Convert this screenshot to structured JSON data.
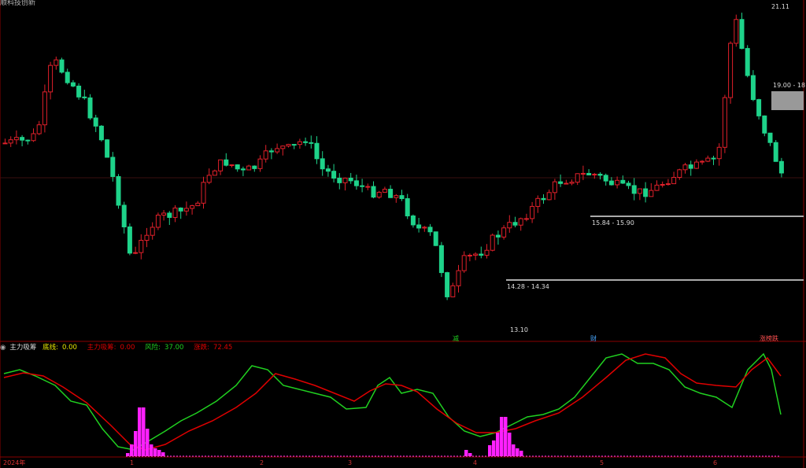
{
  "window": {
    "title": "顺科技创新"
  },
  "main_chart": {
    "price_labels": {
      "high": "21.11",
      "low": "13.10",
      "zone_top": "19.00 - 18",
      "zone_mid": "15.84 - 15.90",
      "zone_low": "14.28 - 14.34"
    },
    "event_markers": {
      "a": "减",
      "b": "财",
      "c": "涨榜跌"
    }
  },
  "indicator": {
    "name": "主力吸筹",
    "items": [
      {
        "label": "底线:",
        "value": "0.00",
        "color": "#e8e800"
      },
      {
        "label": "主力吸筹:",
        "value": "0.00",
        "color": "#e00000"
      },
      {
        "label": "风险:",
        "value": "37.00",
        "color": "#20d020"
      },
      {
        "label": "涨跌:",
        "value": "72.45",
        "color": "#e00000"
      }
    ]
  },
  "time_axis": {
    "year": "2024年",
    "months": [
      "1",
      "2",
      "3",
      "4",
      "5",
      "6"
    ]
  },
  "colors": {
    "up": "#e0202a",
    "down": "#1ed38a",
    "grid": "#8a0000",
    "risk_line": "#20d020",
    "main_line": "#e00000",
    "bars": "#ff20ff"
  }
}
